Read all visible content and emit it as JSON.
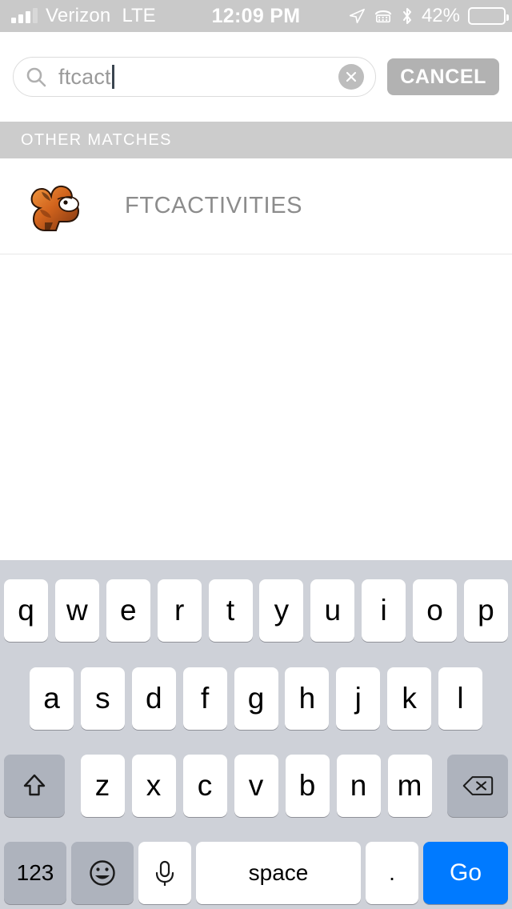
{
  "status_bar": {
    "carrier": "Verizon",
    "network": "LTE",
    "time": "12:09 PM",
    "battery_percent": "42%",
    "battery_level": 42,
    "icons": [
      "signal-bars-icon",
      "location-arrow-icon",
      "tty-icon",
      "bluetooth-icon",
      "battery-icon"
    ],
    "background_color": "#c9c9c9",
    "text_color": "#ffffff"
  },
  "search": {
    "value": "ftcact",
    "placeholder": "Search",
    "cancel_label": "CANCEL",
    "clear_icon": "clear-circle-icon",
    "search_icon": "search-icon"
  },
  "results": {
    "section_header": "OTHER MATCHES",
    "items": [
      {
        "name": "FTCACTIVITIES",
        "logo": "ram-mascot-logo",
        "logo_colors": [
          "#e07a30",
          "#8a3c10",
          "#2b1a10",
          "#ffffff"
        ]
      }
    ]
  },
  "keyboard": {
    "row1": [
      "q",
      "w",
      "e",
      "r",
      "t",
      "y",
      "u",
      "i",
      "o",
      "p"
    ],
    "row2": [
      "a",
      "s",
      "d",
      "f",
      "g",
      "h",
      "j",
      "k",
      "l"
    ],
    "row3": [
      "z",
      "x",
      "c",
      "v",
      "b",
      "n",
      "m"
    ],
    "shift_icon": "shift-arrow-icon",
    "delete_icon": "delete-backspace-icon",
    "numbers_label": "123",
    "emoji_icon": "emoji-smiley-icon",
    "mic_icon": "microphone-icon",
    "space_label": "space",
    "period_label": ".",
    "go_label": "Go",
    "go_color": "#007aff",
    "background_color": "#ced1d8",
    "key_color": "#ffffff",
    "modifier_key_color": "#aeb3bd"
  }
}
